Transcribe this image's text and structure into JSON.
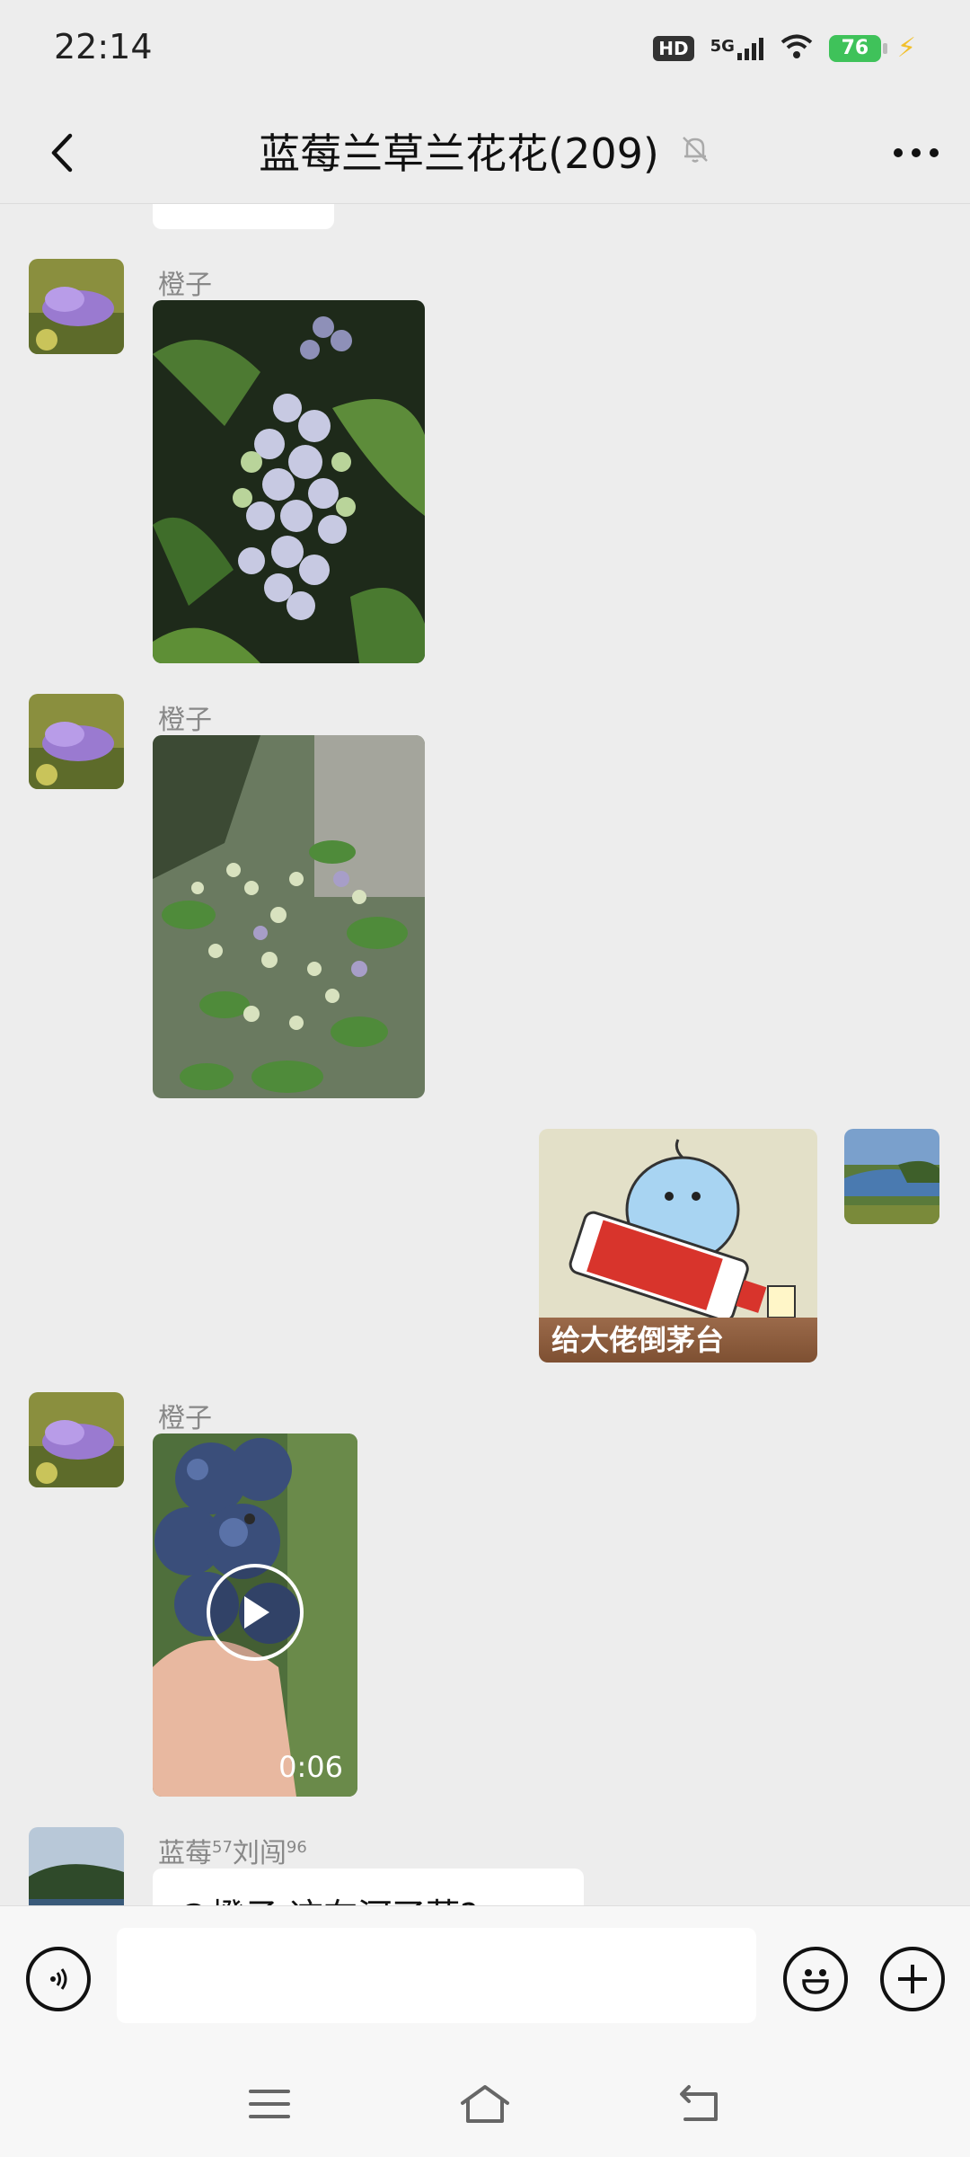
{
  "status": {
    "time": "22:14",
    "hd": "HD",
    "network": "5G",
    "battery": "76"
  },
  "header": {
    "title": "蓝莓兰草兰花花(209)"
  },
  "messages": [
    {
      "sender": "橙子",
      "type": "image"
    },
    {
      "sender": "橙子",
      "type": "image"
    },
    {
      "type": "sticker",
      "caption": "给大佬倒茅台"
    },
    {
      "sender": "橙子",
      "type": "video",
      "duration": "0:06"
    },
    {
      "sender_main": "蓝莓",
      "sender_sup1": "57",
      "sender_mid": "刘闯",
      "sender_sup2": "96",
      "text": "@橙子 这在河了蓝?"
    }
  ],
  "input": {
    "placeholder": ""
  }
}
